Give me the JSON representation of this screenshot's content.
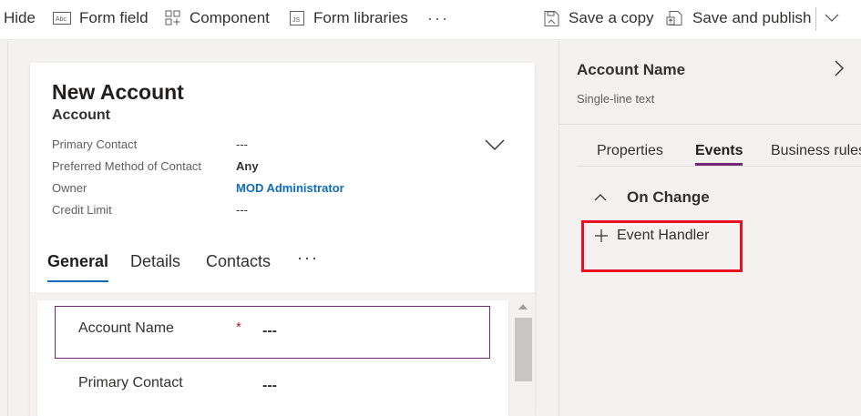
{
  "colors": {
    "accent": "#742774",
    "link": "#0f6cbd",
    "required": "#a4262c",
    "highlight": "#e81123"
  },
  "toolbar": {
    "hide_label": "Hide",
    "form_field_label": "Form field",
    "form_field_icon": "text-field-icon",
    "component_label": "Component",
    "component_icon": "component-grid-icon",
    "form_libraries_label": "Form libraries",
    "form_libraries_icon": "js-file-icon",
    "more_label": "···",
    "save_copy_label": "Save a copy",
    "save_copy_icon": "save-copy-icon",
    "save_publish_label": "Save and publish",
    "save_publish_icon": "publish-icon",
    "dropdown_icon": "chevron-down-icon"
  },
  "form": {
    "title": "New Account",
    "entity": "Account",
    "header_fields": [
      {
        "label": "Primary Contact",
        "value": "---"
      },
      {
        "label": "Preferred Method of Contact",
        "value": "Any"
      },
      {
        "label": "Owner",
        "value": "MOD Administrator"
      },
      {
        "label": "Credit Limit",
        "value": "---"
      }
    ],
    "tabs": [
      "General",
      "Details",
      "Contacts"
    ],
    "active_tab": "General",
    "tabs_more": "···",
    "fields": [
      {
        "label": "Account Name",
        "required_mark": "*",
        "value": "---"
      },
      {
        "label": "Primary Contact",
        "value": "---"
      }
    ]
  },
  "pane": {
    "title": "Account Name",
    "subtitle": "Single-line text",
    "tabs": [
      "Properties",
      "Events",
      "Business rules"
    ],
    "active_tab": "Events",
    "event_group": "On Change",
    "add_handler_label": "Event Handler"
  }
}
